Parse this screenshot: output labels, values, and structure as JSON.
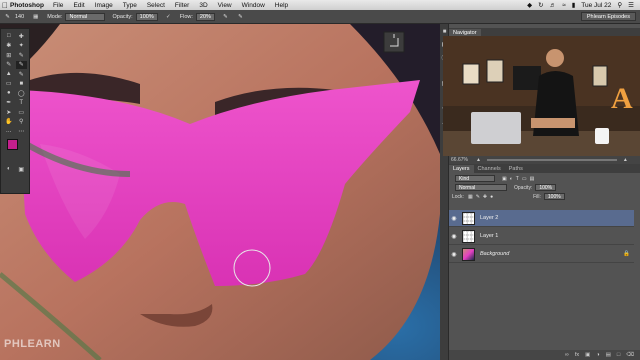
{
  "menubar": {
    "app_name": "Photoshop",
    "items": [
      "File",
      "Edit",
      "Image",
      "Type",
      "Select",
      "Filter",
      "3D",
      "View",
      "Window",
      "Help"
    ],
    "clock": "Tue Jul 22",
    "icons": [
      "dropbox-icon",
      "sync-icon",
      "volume-icon",
      "wifi-icon",
      "battery-icon",
      "search-icon",
      "list-icon"
    ]
  },
  "options_bar": {
    "brush_size": "140",
    "mode_label": "Mode:",
    "mode_value": "Normal",
    "opacity_label": "Opacity:",
    "opacity_value": "100%",
    "flow_label": "Flow:",
    "flow_value": "20%",
    "workspace": "Phlearn Episodes"
  },
  "navigator": {
    "tab_label": "Navigator",
    "zoom": "66.67%"
  },
  "layers_panel": {
    "tabs": [
      "Layers",
      "Channels",
      "Paths"
    ],
    "filter_label": "Kind",
    "blend_mode": "Normal",
    "opacity_label": "Opacity:",
    "opacity_value": "100%",
    "lock_label": "Lock:",
    "fill_label": "Fill:",
    "fill_value": "100%",
    "layers": [
      {
        "name": "Layer 2",
        "selected": true
      },
      {
        "name": "Layer 1",
        "selected": false
      },
      {
        "name": "Background",
        "selected": false
      }
    ],
    "footer_icons": [
      "link-icon",
      "fx-icon",
      "mask-icon",
      "adjustment-icon",
      "group-icon",
      "new-layer-icon",
      "trash-icon"
    ]
  },
  "colors": {
    "foreground": "#c31f8c",
    "background": "#ffffff",
    "glasses": "#e43fc2",
    "selected_layer": "#596b8f"
  },
  "watermark": "PHLEARN"
}
